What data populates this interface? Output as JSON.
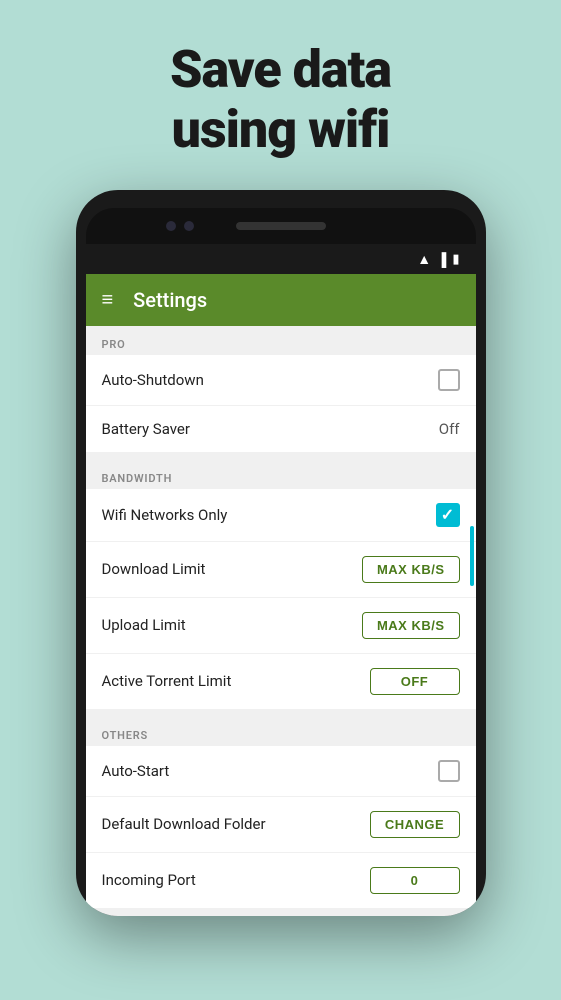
{
  "hero": {
    "line1": "Save data",
    "line2": "using wifi"
  },
  "statusBar": {
    "icons": [
      "wifi",
      "signal",
      "battery"
    ]
  },
  "appBar": {
    "title": "Settings",
    "menuIconLabel": "menu"
  },
  "sections": [
    {
      "header": "PRO",
      "rows": [
        {
          "label": "Auto-Shutdown",
          "control": "checkbox-unchecked"
        },
        {
          "label": "Battery Saver",
          "control": "value",
          "value": "Off"
        }
      ]
    },
    {
      "header": "BANDWIDTH",
      "rows": [
        {
          "label": "Wifi Networks Only",
          "control": "checkbox-checked"
        },
        {
          "label": "Download Limit",
          "control": "button",
          "buttonLabel": "MAX KB/S"
        },
        {
          "label": "Upload Limit",
          "control": "button",
          "buttonLabel": "MAX KB/S"
        },
        {
          "label": "Active Torrent Limit",
          "control": "button",
          "buttonLabel": "OFF"
        }
      ]
    },
    {
      "header": "OTHERS",
      "rows": [
        {
          "label": "Auto-Start",
          "control": "checkbox-unchecked"
        },
        {
          "label": "Default Download Folder",
          "control": "button",
          "buttonLabel": "CHANGE"
        },
        {
          "label": "Incoming Port",
          "control": "button",
          "buttonLabel": "0"
        }
      ]
    }
  ]
}
